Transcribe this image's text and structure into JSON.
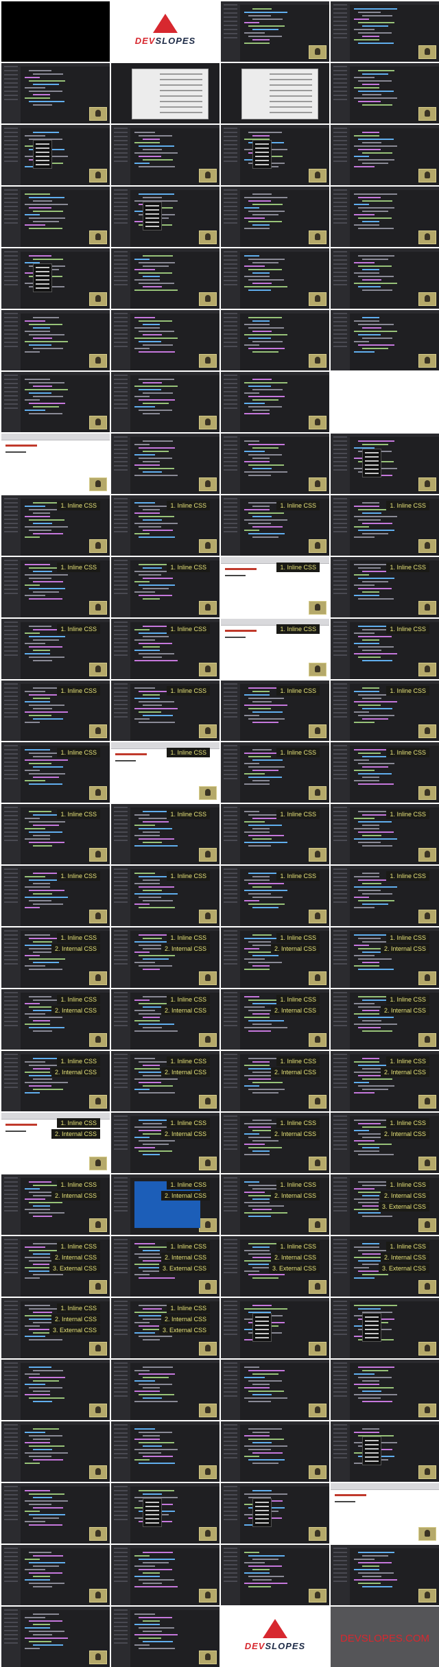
{
  "brand": {
    "logo_text_a": "DEV",
    "logo_text_b": "SLOPES",
    "url": "DEVSLOPES.COM"
  },
  "labels": {
    "inline": "1. Inline CSS",
    "internal": "2. Internal CSS",
    "external": "3. External CSS"
  },
  "accent": "#d7282f",
  "label_color": "#e8e47a",
  "tiles": [
    {
      "k": "black"
    },
    {
      "k": "logo"
    },
    {
      "k": "editor",
      "n": 0
    },
    {
      "k": "editor",
      "n": 0
    },
    {
      "k": "editor"
    },
    {
      "k": "finder"
    },
    {
      "k": "finder"
    },
    {
      "k": "editor"
    },
    {
      "k": "menu"
    },
    {
      "k": "editor"
    },
    {
      "k": "menu"
    },
    {
      "k": "editor"
    },
    {
      "k": "editor"
    },
    {
      "k": "menu"
    },
    {
      "k": "editor"
    },
    {
      "k": "editor"
    },
    {
      "k": "menu"
    },
    {
      "k": "editor"
    },
    {
      "k": "editor"
    },
    {
      "k": "editor"
    },
    {
      "k": "editor"
    },
    {
      "k": "editor"
    },
    {
      "k": "editor"
    },
    {
      "k": "editor"
    },
    {
      "k": "editor"
    },
    {
      "k": "editor"
    },
    {
      "k": "editor"
    },
    {
      "k": "white"
    },
    {
      "k": "browser"
    },
    {
      "k": "editor"
    },
    {
      "k": "editor"
    },
    {
      "k": "menu"
    },
    {
      "k": "editor",
      "n": 1
    },
    {
      "k": "editor",
      "n": 1
    },
    {
      "k": "editor",
      "n": 1
    },
    {
      "k": "editor",
      "n": 1
    },
    {
      "k": "editor",
      "n": 1
    },
    {
      "k": "editor",
      "n": 1
    },
    {
      "k": "browser",
      "n": 1
    },
    {
      "k": "editor",
      "n": 1
    },
    {
      "k": "editor",
      "n": 1
    },
    {
      "k": "editor",
      "n": 1
    },
    {
      "k": "browser",
      "n": 1
    },
    {
      "k": "editor",
      "n": 1
    },
    {
      "k": "editor",
      "n": 1
    },
    {
      "k": "editor",
      "n": 1
    },
    {
      "k": "editor",
      "n": 1
    },
    {
      "k": "editor",
      "n": 1
    },
    {
      "k": "editor",
      "n": 1
    },
    {
      "k": "browser",
      "n": 1
    },
    {
      "k": "editor",
      "n": 1
    },
    {
      "k": "editor",
      "n": 1
    },
    {
      "k": "editor",
      "n": 1
    },
    {
      "k": "editor",
      "n": 1
    },
    {
      "k": "editor",
      "n": 1
    },
    {
      "k": "editor",
      "n": 1
    },
    {
      "k": "editor",
      "n": 1
    },
    {
      "k": "editor",
      "n": 1
    },
    {
      "k": "editor",
      "n": 1
    },
    {
      "k": "editor",
      "n": 1
    },
    {
      "k": "editor",
      "n": 2
    },
    {
      "k": "editor",
      "n": 2
    },
    {
      "k": "editor",
      "n": 2
    },
    {
      "k": "editor",
      "n": 2
    },
    {
      "k": "editor",
      "n": 2
    },
    {
      "k": "editor",
      "n": 2
    },
    {
      "k": "editor",
      "n": 2
    },
    {
      "k": "editor",
      "n": 2
    },
    {
      "k": "editor",
      "n": 2
    },
    {
      "k": "editor",
      "n": 2
    },
    {
      "k": "editor",
      "n": 2
    },
    {
      "k": "editor",
      "n": 2
    },
    {
      "k": "browser",
      "n": 2
    },
    {
      "k": "editor",
      "n": 2
    },
    {
      "k": "editor",
      "n": 2
    },
    {
      "k": "editor",
      "n": 2
    },
    {
      "k": "editor",
      "n": 2
    },
    {
      "k": "sel",
      "n": 2
    },
    {
      "k": "editor",
      "n": 2
    },
    {
      "k": "editor",
      "n": 3
    },
    {
      "k": "editor",
      "n": 3
    },
    {
      "k": "editor",
      "n": 3
    },
    {
      "k": "editor",
      "n": 3
    },
    {
      "k": "editor",
      "n": 3
    },
    {
      "k": "editor",
      "n": 3
    },
    {
      "k": "editor",
      "n": 3
    },
    {
      "k": "menu"
    },
    {
      "k": "menu"
    },
    {
      "k": "editor"
    },
    {
      "k": "editor"
    },
    {
      "k": "editor"
    },
    {
      "k": "editor"
    },
    {
      "k": "editor"
    },
    {
      "k": "editor"
    },
    {
      "k": "editor"
    },
    {
      "k": "menu"
    },
    {
      "k": "editor"
    },
    {
      "k": "menu"
    },
    {
      "k": "menu"
    },
    {
      "k": "browser"
    },
    {
      "k": "editor"
    },
    {
      "k": "editor"
    },
    {
      "k": "editor"
    },
    {
      "k": "editor"
    },
    {
      "k": "editor"
    },
    {
      "k": "editor"
    },
    {
      "k": "logo"
    },
    {
      "k": "url"
    }
  ]
}
